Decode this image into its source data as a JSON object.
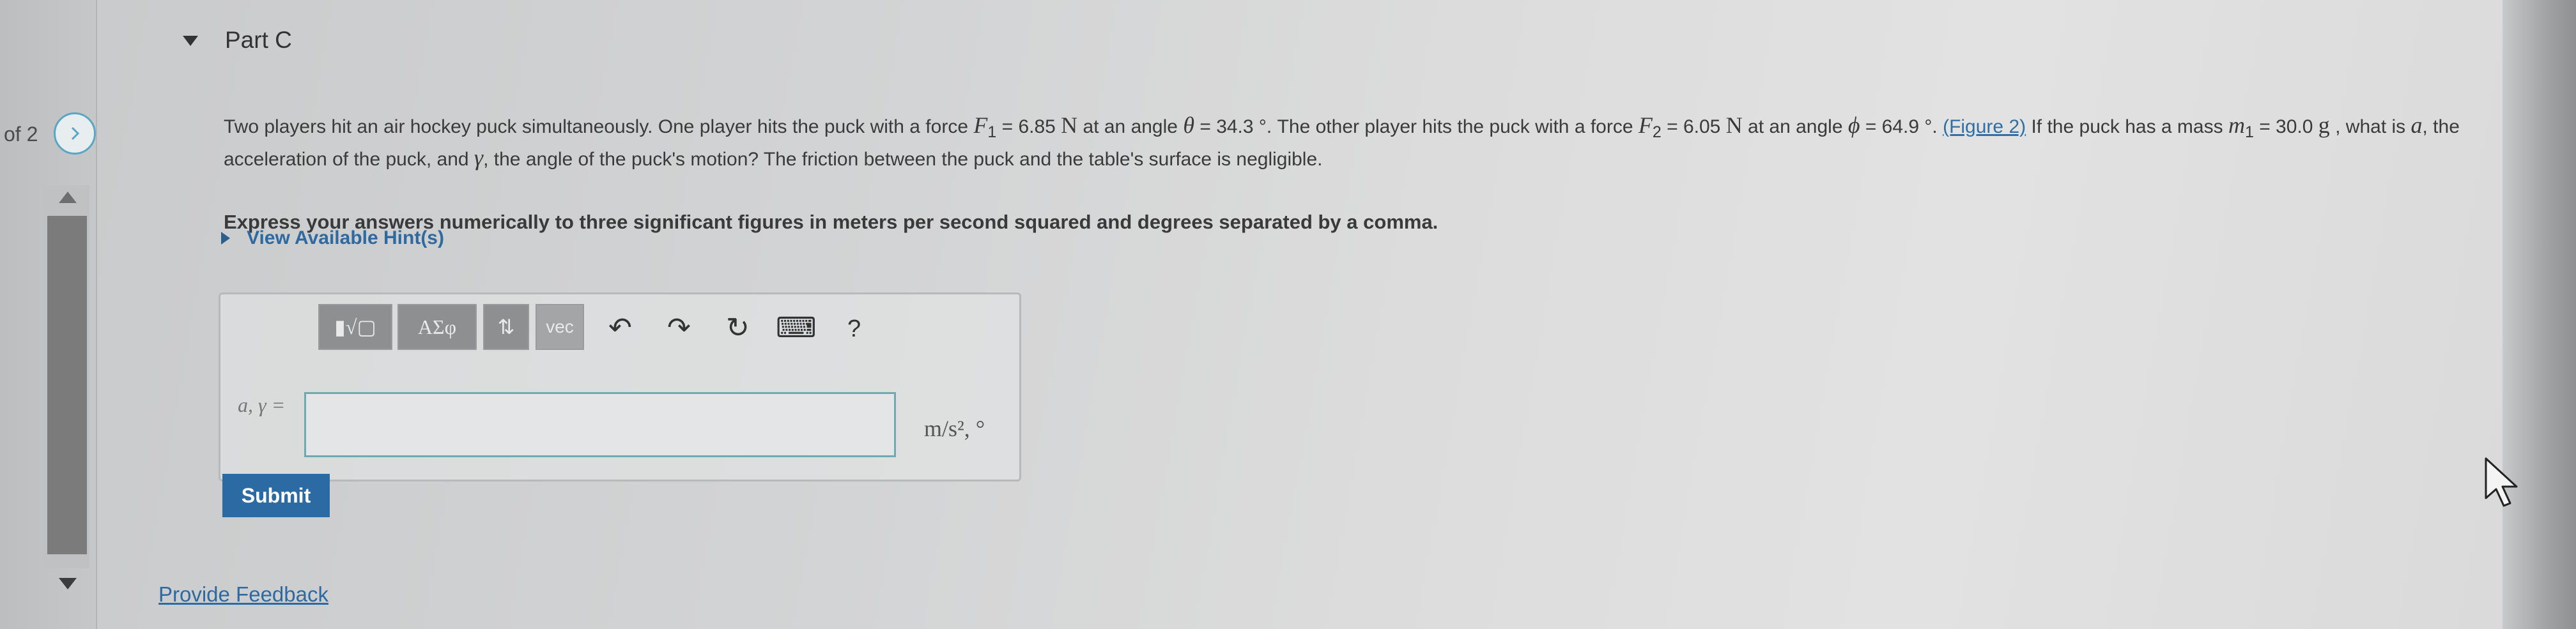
{
  "nav": {
    "page_indicator": "of 2",
    "next_icon": "chevron-right-icon"
  },
  "part": {
    "title": "Part C"
  },
  "question": {
    "t1": "Two players hit an air hockey puck simultaneously. One player hits the puck with a force ",
    "f1_var": "F",
    "f1_sub": "1",
    "t2": " = 6.85 ",
    "unit_n1": "N",
    "t3": " at an angle ",
    "theta": "θ",
    "t4": " = 34.3 °. The other player hits the puck with a force ",
    "f2_var": "F",
    "f2_sub": "2",
    "t5": " = 6.05 ",
    "unit_n2": "N",
    "t6": " at an angle ",
    "phi": "ϕ",
    "t7": " = 64.9 °. ",
    "figure_link": "(Figure 2)",
    "t8": " If the puck has a mass ",
    "m_var": "m",
    "m_sub": "1",
    "t9": " = 30.0 ",
    "unit_g": "g",
    "t10": " , what is ",
    "a_var": "a",
    "t11": ", the acceleration of the puck, and ",
    "gamma": "γ",
    "t12": ", the angle of the puck's motion? The friction between the puck and the table's surface is negligible."
  },
  "instruction": "Express your answers numerically to three significant figures in meters per second squared and degrees separated by a comma.",
  "hint": {
    "label": "View Available Hint(s)"
  },
  "toolbar": {
    "templates": "▮√▢",
    "greek": "ΑΣφ",
    "arrows": "⇅",
    "vec": "vec",
    "undo": "↶",
    "redo": "↷",
    "reset": "↻",
    "keyboard": "⌨",
    "help": "?"
  },
  "answer": {
    "label": "a, γ =",
    "value": "",
    "units": "m/s², °"
  },
  "submit_label": "Submit",
  "feedback_label": "Provide Feedback"
}
